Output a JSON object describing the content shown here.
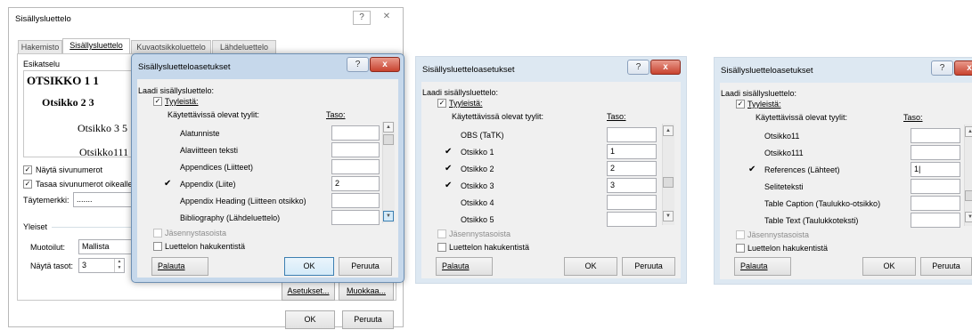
{
  "main_dialog": {
    "title": "Sisällysluettelo",
    "help_glyph": "?",
    "close_glyph": "✕",
    "tabs": [
      "Hakemisto",
      "Sisällysluettelo",
      "Kuvaotsikkoluettelo",
      "Lähdeluettelo"
    ],
    "preview_label": "Esikatselu",
    "preview_lines": [
      "OTSIKKO 1 1",
      "Otsikko 2 3",
      "Otsikko 3 5",
      "Otsikko111 5"
    ],
    "show_page_numbers": "Näytä sivunumerot",
    "align_page_numbers": "Tasaa sivunumerot oikealle",
    "tab_leader_label": "Täytemerkki:",
    "tab_leader_value": ".......",
    "general_label": "Yleiset",
    "formats_label": "Muotoilut:",
    "formats_value": "Mallista",
    "show_levels_label": "Näytä tasot:",
    "show_levels_value": "3",
    "options_button": "Asetukset...",
    "modify_button": "Muokkaa...",
    "ok_button": "OK",
    "cancel_button": "Peruuta"
  },
  "options_common": {
    "title": "Sisällysluetteloasetukset",
    "build_from": "Laadi sisällysluettelo:",
    "styles_check": "Tyyleistä:",
    "available_styles": "Käytettävissä olevat tyylit:",
    "level_header": "Taso:",
    "outline_levels": "Jäsennystasoista",
    "entry_fields": "Luettelon hakukentistä",
    "reset_button": "Palauta",
    "ok_button": "OK",
    "cancel_button": "Peruuta",
    "help_glyph": "?",
    "close_glyph": "x"
  },
  "dialog1_styles": [
    {
      "name": "Alatunniste",
      "checked": false,
      "level": ""
    },
    {
      "name": "Alaviitteen teksti",
      "checked": false,
      "level": ""
    },
    {
      "name": "Appendices (Liitteet)",
      "checked": false,
      "level": ""
    },
    {
      "name": "Appendix (Liite)",
      "checked": true,
      "level": "2"
    },
    {
      "name": "Appendix Heading (Liitteen otsikko)",
      "checked": false,
      "level": ""
    },
    {
      "name": "Bibliography (Lähdeluettelo)",
      "checked": false,
      "level": ""
    }
  ],
  "dialog2_styles": [
    {
      "name": "OBS (TaTK)",
      "checked": false,
      "level": ""
    },
    {
      "name": "Otsikko 1",
      "checked": true,
      "level": "1"
    },
    {
      "name": "Otsikko 2",
      "checked": true,
      "level": "2"
    },
    {
      "name": "Otsikko 3",
      "checked": true,
      "level": "3"
    },
    {
      "name": "Otsikko 4",
      "checked": false,
      "level": ""
    },
    {
      "name": "Otsikko 5",
      "checked": false,
      "level": ""
    }
  ],
  "dialog3_styles": [
    {
      "name": "Otsikko11",
      "checked": false,
      "level": ""
    },
    {
      "name": "Otsikko111",
      "checked": false,
      "level": ""
    },
    {
      "name": "References (Lähteet)",
      "checked": true,
      "level": "1|"
    },
    {
      "name": "Seliteteksti",
      "checked": false,
      "level": ""
    },
    {
      "name": "Table Caption (Taulukko-otsikko)",
      "checked": false,
      "level": ""
    },
    {
      "name": "Table Text (Taulukkoteksti)",
      "checked": false,
      "level": ""
    }
  ]
}
